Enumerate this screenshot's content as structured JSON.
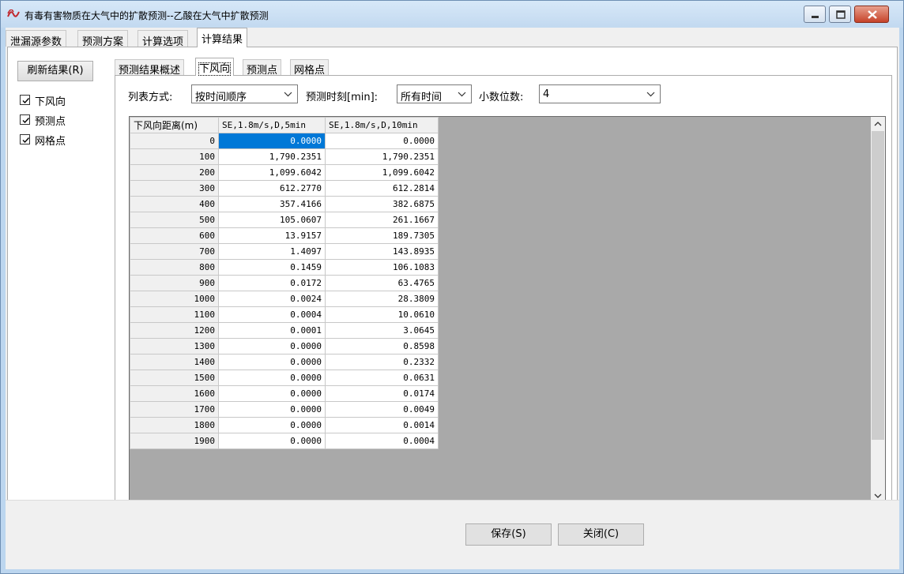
{
  "window": {
    "title": "有毒有害物质在大气中的扩散预测--乙酸在大气中扩散预测"
  },
  "top_tabs": [
    "泄漏源参数",
    "预测方案",
    "计算选项",
    "计算结果"
  ],
  "active_top_tab": "计算结果",
  "left_panel": {
    "refresh_label": "刷新结果(R)",
    "checkboxes": [
      {
        "label": "下风向",
        "checked": true
      },
      {
        "label": "预测点",
        "checked": true
      },
      {
        "label": "网格点",
        "checked": true
      }
    ]
  },
  "sub_tabs": [
    "预测结果概述",
    "下风向",
    "预测点",
    "网格点"
  ],
  "active_sub_tab": "下风向",
  "options": {
    "list_mode_label": "列表方式:",
    "list_mode_value": "按时间顺序",
    "time_label": "预测时刻[min]:",
    "time_value": "所有时间",
    "decimals_label": "小数位数:",
    "decimals_value": "4"
  },
  "grid": {
    "headers": [
      "下风向距离(m)",
      "SE,1.8m/s,D,5min",
      "SE,1.8m/s,D,10min"
    ],
    "rows": [
      [
        "0",
        "0.0000",
        "0.0000"
      ],
      [
        "100",
        "1,790.2351",
        "1,790.2351"
      ],
      [
        "200",
        "1,099.6042",
        "1,099.6042"
      ],
      [
        "300",
        "612.2770",
        "612.2814"
      ],
      [
        "400",
        "357.4166",
        "382.6875"
      ],
      [
        "500",
        "105.0607",
        "261.1667"
      ],
      [
        "600",
        "13.9157",
        "189.7305"
      ],
      [
        "700",
        "1.4097",
        "143.8935"
      ],
      [
        "800",
        "0.1459",
        "106.1083"
      ],
      [
        "900",
        "0.0172",
        "63.4765"
      ],
      [
        "1000",
        "0.0024",
        "28.3809"
      ],
      [
        "1100",
        "0.0004",
        "10.0610"
      ],
      [
        "1200",
        "0.0001",
        "3.0645"
      ],
      [
        "1300",
        "0.0000",
        "0.8598"
      ],
      [
        "1400",
        "0.0000",
        "0.2332"
      ],
      [
        "1500",
        "0.0000",
        "0.0631"
      ],
      [
        "1600",
        "0.0000",
        "0.0174"
      ],
      [
        "1700",
        "0.0000",
        "0.0049"
      ],
      [
        "1800",
        "0.0000",
        "0.0014"
      ],
      [
        "1900",
        "0.0000",
        "0.0004"
      ]
    ],
    "selected_cell": "0.0000"
  },
  "buttons": {
    "save": "保存(S)",
    "close": "关闭(C)"
  },
  "colors": {
    "selection": "#0078d7",
    "grid_background": "#a9a9a9",
    "titlebar": "#c9ddf2"
  }
}
